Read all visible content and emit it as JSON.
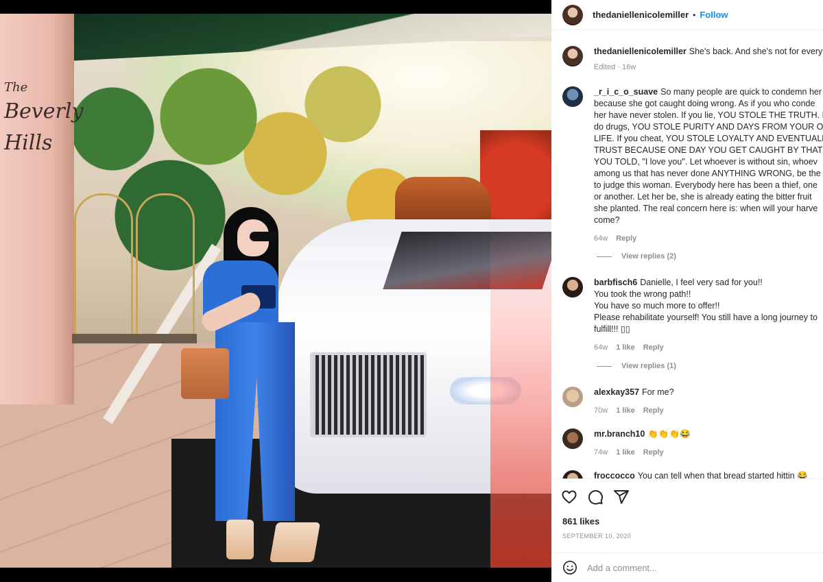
{
  "post": {
    "username": "thedaniellenicolemiller",
    "follow_label": "Follow",
    "separator": "•",
    "hotel_sign": [
      "The",
      "Beverly",
      "Hills"
    ],
    "caption": {
      "user": "thedaniellenicolemiller",
      "text": "She's back. And she's not for every",
      "meta": "Edited · 16w"
    }
  },
  "comments": [
    {
      "user": "_r_i_c_o_suave",
      "lines": [
        "So many people are quick to condemn her",
        "because she got caught doing wrong. As if you who conde",
        "her have never stolen. If you lie, YOU STOLE THE TRUTH. If",
        "do drugs, YOU STOLE PURITY AND DAYS FROM YOUR OW",
        "LIFE. If you cheat, YOU STOLE LOYALTY AND EVENTUALLY",
        "TRUST BECAUSE ONE DAY YOU GET CAUGHT BY THAT PER",
        "YOU TOLD, \"I love you\". Let whoever is without sin, whoev",
        "among us that has never done ANYTHING WRONG, be the",
        "to judge this woman. Everybody here has been a thief, one",
        "or another. Let her be, she is already eating the bitter fruit",
        "she planted. The real concern here is: when will your harve",
        "come?"
      ],
      "time": "64w",
      "likes": "",
      "reply": "Reply",
      "view_replies": "View replies (2)"
    },
    {
      "user": "barbfisch6",
      "lines": [
        "Danielle, I feel very sad for you!!",
        "You took the wrong path!!",
        "You have so much more to offer!!",
        "Please rehabilitate yourself! You still have a long journey to",
        "fulfill!!! ▯▯"
      ],
      "time": "64w",
      "likes": "1 like",
      "reply": "Reply",
      "view_replies": "View replies (1)"
    },
    {
      "user": "alexkay357",
      "lines": [
        "For me?"
      ],
      "time": "70w",
      "likes": "1 like",
      "reply": "Reply"
    },
    {
      "user": "mr.branch10",
      "lines": [
        "👏👏👏😂"
      ],
      "time": "74w",
      "likes": "1 like",
      "reply": "Reply"
    },
    {
      "user": "froccocco",
      "lines": [
        "You can tell when that bread started hittin 😂"
      ],
      "time": "",
      "likes": "",
      "reply": ""
    }
  ],
  "actions": {
    "likes": "861 likes",
    "date": "SEPTEMBER 10, 2020",
    "comment_placeholder": "Add a comment..."
  },
  "icons": [
    "heart-icon",
    "comment-icon",
    "share-icon",
    "emoji-icon"
  ]
}
